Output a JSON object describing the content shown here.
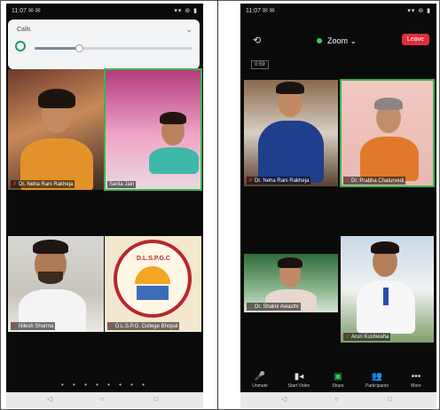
{
  "left_phone": {
    "status_time": "11:07 ✉ ✉",
    "status_right": "▾▾ ⊚ ▮",
    "popup": {
      "title": "Calls",
      "level": 0.28
    },
    "tiles": [
      {
        "label": "Dr. Neha Rani Rakheja"
      },
      {
        "label": "Sarita Jain"
      },
      {
        "label": "Nilesh Sharma"
      },
      {
        "label": "D.L.S.P.G. College Bhopal"
      }
    ],
    "logo_text": "D.L.S.P.G.C",
    "page_dots": "• • • • • • • •"
  },
  "right_phone": {
    "status_time": "11:07 ✉ ✉",
    "status_right": "▾▾ ⊚ ▮",
    "header": {
      "app": "Zoom",
      "leave_label": "Leave"
    },
    "badge": "0:59",
    "tiles": [
      {
        "label": "Dr. Neha Rani Rakheja"
      },
      {
        "label": "Dr. Prabha Chaturvedi"
      },
      {
        "label": "Dr. Shalini Awasthi"
      },
      {
        "label": "Arun Kushwaha"
      }
    ],
    "toolbar": [
      {
        "icon": "🎤",
        "label": "Unmute"
      },
      {
        "icon": "▮◂",
        "label": "Start Video"
      },
      {
        "icon": "▣",
        "label": "Share"
      },
      {
        "icon": "👥",
        "label": "Participants"
      },
      {
        "icon": "•••",
        "label": "More"
      }
    ]
  },
  "navbar": {
    "back": "◁",
    "home": "○",
    "recent": "□"
  },
  "colors": {
    "active_outline": "#3bb54a",
    "leave": "#e02f3b",
    "zoom_dot": "#2fd35a"
  }
}
